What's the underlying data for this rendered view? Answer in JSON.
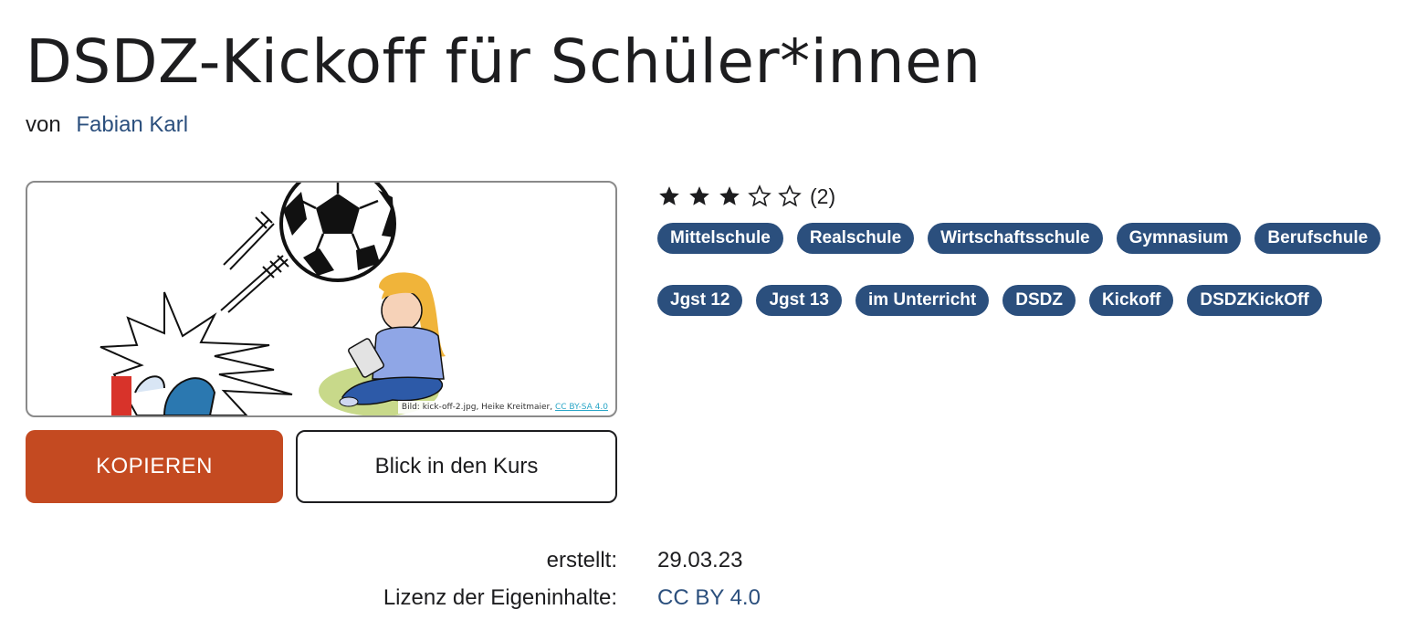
{
  "course": {
    "title": "DSDZ-Kickoff für Schüler*innen",
    "by_label": "von",
    "author": "Fabian Karl"
  },
  "image": {
    "credit_text": "Bild: kick-off-2.jpg, Heike Kreitmaier,",
    "credit_license": "CC BY-SA 4.0"
  },
  "actions": {
    "copy_label": "KOPIEREN",
    "view_label": "Blick in den Kurs"
  },
  "rating": {
    "value": 3,
    "max": 5,
    "count_text": "(2)"
  },
  "tags_row1": [
    "Mittelschule",
    "Realschule",
    "Wirtschaftsschule",
    "Gymnasium",
    "Berufschule"
  ],
  "tags_row2": [
    "Jgst 12",
    "Jgst 13",
    "im Unterricht",
    "DSDZ",
    "Kickoff",
    "DSDZKickOff"
  ],
  "meta": {
    "created_label": "erstellt:",
    "created_value": "29.03.23",
    "license_label": "Lizenz der Eigeninhalte:",
    "license_value": "CC BY 4.0"
  },
  "colors": {
    "accent": "#2b4f7d",
    "copy_button": "#c44a21",
    "text": "#1d1d1f"
  }
}
